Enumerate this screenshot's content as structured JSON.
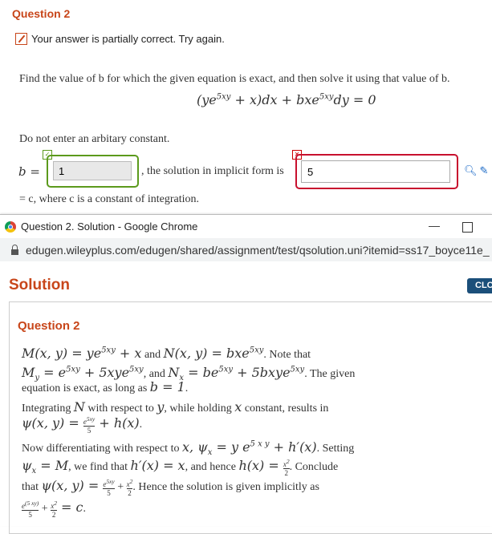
{
  "question": {
    "title": "Question 2",
    "feedback": "Your answer is partially correct.  Try again.",
    "problem_text": "Find the value of b for which the given equation is exact, and then solve it using that value of b.",
    "equation": "(ye^{5xy} + x)dx + bxe^{5xy}dy = 0",
    "note": "Do not enter an arbitary constant.",
    "b_label": "b =",
    "b_value": "1",
    "mid_text": ", the solution in implicit form is",
    "solution_value": "5",
    "after_text": "= c, where c is a constant of integration."
  },
  "popup": {
    "window_title": "Question 2. Solution - Google Chrome",
    "url": "edugen.wileyplus.com/edugen/shared/assignment/test/qsolution.uni?itemid=ss17_boyce11e_",
    "heading": "Solution",
    "close_label": "CLO",
    "question_title": "Question 2",
    "lines": [
      "M(x, y) = ye^{5xy} + x and N(x, y) = bxe^{5xy}. Note that",
      "M_y = e^{5xy} + 5xye^{5xy}, and N_x = be^{5xy} + 5bxye^{5xy}.  The given",
      "equation is exact, as long as b = 1.",
      "Integrating N with respect to y, while holding x constant, results in",
      "ψ(x, y) = e^{5xy}/5 + h(x).",
      "Now differentiating with respect to x, ψ_x = y e^{5 x y} + h′(x). Setting",
      "ψ_x = M, we find that h′(x) = x, and hence h(x) = x²/2. Conclude",
      "that ψ(x, y) = e^{5xy}/5 + x²/2. Hence the solution is given implicitly as",
      "e^{(5 xy)}/5 + x²/2 = c."
    ]
  },
  "colors": {
    "accent": "#c8461a",
    "correct": "#5b9a1c",
    "incorrect": "#c8102e",
    "link": "#1c6ac7"
  }
}
